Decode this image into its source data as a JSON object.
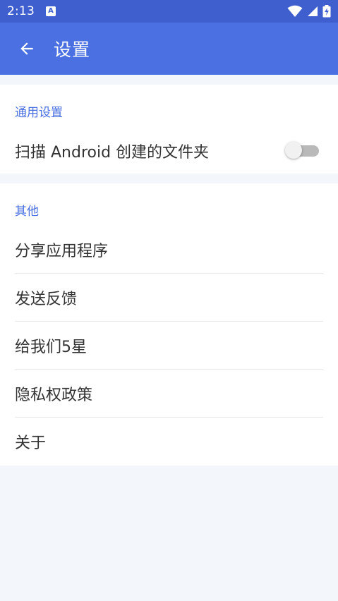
{
  "status_bar": {
    "time": "2:13",
    "app_icon_letter": "A"
  },
  "app_bar": {
    "title": "设置"
  },
  "general": {
    "header": "通用设置",
    "scan_android_label": "扫描 Android 创建的文件夹",
    "scan_android_enabled": false
  },
  "other": {
    "header": "其他",
    "items": [
      {
        "label": "分享应用程序"
      },
      {
        "label": "发送反馈"
      },
      {
        "label": "给我们5星"
      },
      {
        "label": "隐私权政策"
      },
      {
        "label": "关于"
      }
    ]
  },
  "colors": {
    "status_bar": "#3f5fcf",
    "app_bar": "#4a70e2",
    "accent": "#4a70e2",
    "background": "#f3f6fa"
  }
}
